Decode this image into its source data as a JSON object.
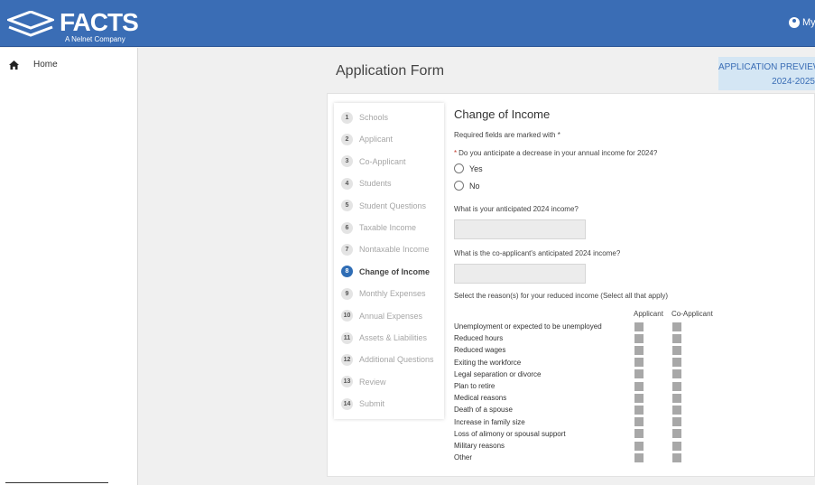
{
  "header": {
    "logo_text": "FACTS",
    "logo_sub": "A Nelnet Company",
    "user_label": "My"
  },
  "sidebar": {
    "home_label": "Home"
  },
  "page": {
    "title": "Application Form",
    "preview_line1": "APPLICATION PREVIEW",
    "preview_line2": "2024-2025"
  },
  "steps": [
    {
      "num": "1",
      "label": "Schools"
    },
    {
      "num": "2",
      "label": "Applicant"
    },
    {
      "num": "3",
      "label": "Co-Applicant"
    },
    {
      "num": "4",
      "label": "Students"
    },
    {
      "num": "5",
      "label": "Student Questions"
    },
    {
      "num": "6",
      "label": "Taxable Income"
    },
    {
      "num": "7",
      "label": "Nontaxable Income"
    },
    {
      "num": "8",
      "label": "Change of Income"
    },
    {
      "num": "9",
      "label": "Monthly Expenses"
    },
    {
      "num": "10",
      "label": "Annual Expenses"
    },
    {
      "num": "11",
      "label": "Assets & Liabilities"
    },
    {
      "num": "12",
      "label": "Additional Questions"
    },
    {
      "num": "13",
      "label": "Review"
    },
    {
      "num": "14",
      "label": "Submit"
    }
  ],
  "active_step": "8",
  "form": {
    "title": "Change of Income",
    "required_note": "Required fields are marked with *",
    "question_asterisk": "*",
    "question": "Do you anticipate a decrease in your annual income for 2024?",
    "option_yes": "Yes",
    "option_no": "No",
    "applicant_income_label": "What is your anticipated 2024 income?",
    "applicant_income_value": "",
    "coapplicant_income_label": "What is the co-applicant's anticipated 2024 income?",
    "coapplicant_income_value": "",
    "reasons_label": "Select the reason(s) for your reduced income (Select all that apply)",
    "col_applicant": "Applicant",
    "col_coapplicant": "Co-Applicant",
    "reasons": [
      "Unemployment or expected to be unemployed",
      "Reduced hours",
      "Reduced wages",
      "Exiting the workforce",
      "Legal separation or divorce",
      "Plan to retire",
      "Medical reasons",
      "Death of a spouse",
      "Increase in family size",
      "Loss of alimony or spousal support",
      "Military reasons",
      "Other"
    ]
  },
  "colors": {
    "header": "#3a6db5",
    "active_step": "#2f6db5",
    "preview_bg": "#d4e6f4"
  }
}
